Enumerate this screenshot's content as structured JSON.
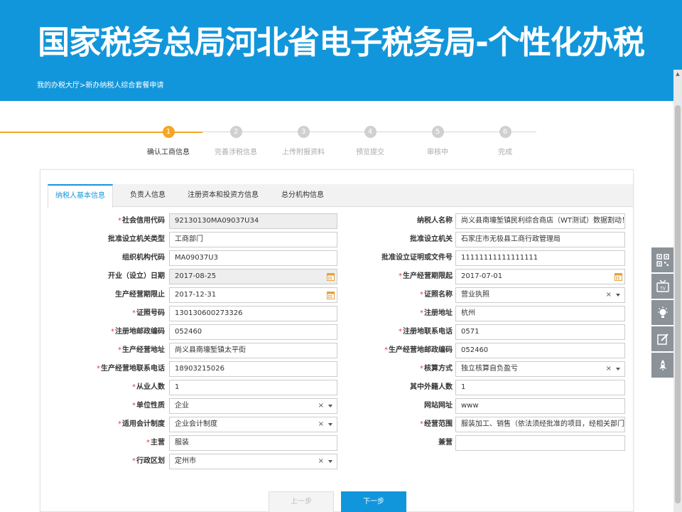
{
  "banner": {
    "title": "国家税务总局河北省电子税务局-个性化办税"
  },
  "breadcrumb": "我的办税大厅>新办纳税人综合套餐申请",
  "steps": [
    {
      "num": "1",
      "label": "确认工商信息",
      "active": true
    },
    {
      "num": "2",
      "label": "完善涉税信息",
      "active": false
    },
    {
      "num": "3",
      "label": "上传附报资料",
      "active": false
    },
    {
      "num": "4",
      "label": "预览提交",
      "active": false
    },
    {
      "num": "5",
      "label": "审核中",
      "active": false
    },
    {
      "num": "6",
      "label": "完成",
      "active": false
    }
  ],
  "tabs": [
    "纳税人基本信息",
    "负责人信息",
    "注册资本和投资方信息",
    "总分机构信息"
  ],
  "form": {
    "left": [
      {
        "label": "社会信用代码",
        "req": true,
        "value": "92130130MA09037U34",
        "kind": "readonly"
      },
      {
        "label": "批准设立机关类型",
        "req": false,
        "value": "工商部门",
        "kind": "text"
      },
      {
        "label": "组织机构代码",
        "req": false,
        "value": "MA09037U3",
        "kind": "text"
      },
      {
        "label": "开业（设立）日期",
        "req": false,
        "value": "2017-08-25",
        "kind": "date-readonly"
      },
      {
        "label": "生产经营期限止",
        "req": false,
        "value": "2017-12-31",
        "kind": "date"
      },
      {
        "label": "证照号码",
        "req": true,
        "value": "130130600273326",
        "kind": "text"
      },
      {
        "label": "注册地邮政编码",
        "req": true,
        "value": "052460",
        "kind": "text"
      },
      {
        "label": "生产经营地址",
        "req": true,
        "value": "尚义县南壕堑镇太平街",
        "kind": "text"
      },
      {
        "label": "生产经营地联系电话",
        "req": true,
        "value": "18903215026",
        "kind": "text"
      },
      {
        "label": "从业人数",
        "req": true,
        "value": "1",
        "kind": "text"
      },
      {
        "label": "单位性质",
        "req": true,
        "value": "企业",
        "kind": "select"
      },
      {
        "label": "适用会计制度",
        "req": true,
        "value": "企业会计制度",
        "kind": "select"
      },
      {
        "label": "主营",
        "req": true,
        "value": "服装",
        "kind": "text"
      },
      {
        "label": "行政区划",
        "req": true,
        "value": "定州市",
        "kind": "select"
      }
    ],
    "right": [
      {
        "label": "纳税人名称",
        "req": false,
        "value": "尚义县南壕堑镇民利综合商店（WT测试）数据割动！",
        "kind": "text"
      },
      {
        "label": "批准设立机关",
        "req": false,
        "value": "石家庄市无极县工商行政管理局",
        "kind": "text"
      },
      {
        "label": "批准设立证明或文件号",
        "req": false,
        "value": "11111111111111111",
        "kind": "text"
      },
      {
        "label": "生产经营期限起",
        "req": true,
        "value": "2017-07-01",
        "kind": "date"
      },
      {
        "label": "证照名称",
        "req": true,
        "value": "营业执照",
        "kind": "select"
      },
      {
        "label": "注册地址",
        "req": true,
        "value": "杭州",
        "kind": "text"
      },
      {
        "label": "注册地联系电话",
        "req": true,
        "value": "0571",
        "kind": "text"
      },
      {
        "label": "生产经营地邮政编码",
        "req": true,
        "value": "052460",
        "kind": "text"
      },
      {
        "label": "核算方式",
        "req": true,
        "value": "独立核算自负盈亏",
        "kind": "select"
      },
      {
        "label": "其中外籍人数",
        "req": false,
        "value": "1",
        "kind": "text"
      },
      {
        "label": "网站网址",
        "req": false,
        "value": "www",
        "kind": "text"
      },
      {
        "label": "经营范围",
        "req": true,
        "value": "服装加工、销售（依法须经批准的项目，经相关部门批准后方可开展经营活动）",
        "kind": "text"
      },
      {
        "label": "兼营",
        "req": false,
        "value": "",
        "kind": "text"
      }
    ]
  },
  "buttons": {
    "prev": "上一步",
    "next": "下一步"
  },
  "side_tools": [
    "qrcode-icon",
    "tv-icon",
    "lightbulb-icon",
    "edit-icon",
    "rocket-icon"
  ],
  "colors": {
    "primary": "#1296db",
    "active_step": "#f5a623",
    "required": "#e4393c"
  }
}
